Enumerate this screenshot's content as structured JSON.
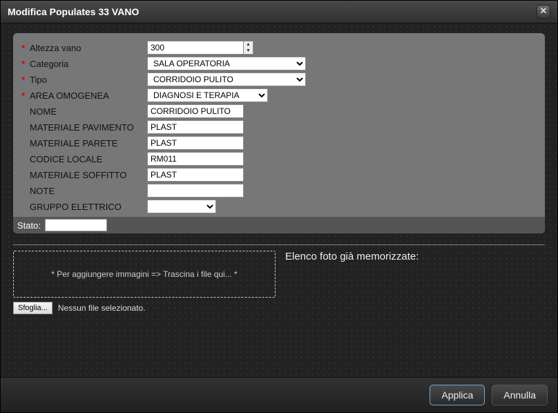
{
  "title": "Modifica Populates 33 VANO",
  "form": {
    "altezza_label": "Altezza vano",
    "altezza_value": "300",
    "categoria_label": "Categoria",
    "categoria_value": "SALA OPERATORIA",
    "tipo_label": "Tipo",
    "tipo_value": "CORRIDOIO PULITO",
    "area_label": "AREA OMOGENEA",
    "area_value": "DIAGNOSI E TERAPIA",
    "nome_label": "NOME",
    "nome_value": "CORRIDOIO PULITO",
    "mat_pav_label": "MATERIALE PAVIMENTO",
    "mat_pav_value": "PLAST",
    "mat_par_label": "MATERIALE PARETE",
    "mat_par_value": "PLAST",
    "codice_label": "CODICE LOCALE",
    "codice_value": "RM011",
    "mat_sof_label": "MATERIALE SOFFITTO",
    "mat_sof_value": "PLAST",
    "note_label": "NOTE",
    "note_value": "",
    "gruppo_label": "GRUPPO ELETTRICO",
    "gruppo_value": "",
    "stato_label": "Stato:",
    "stato_value": ""
  },
  "dropzone_text": "* Per aggiungere immagini => Trascina i file qui... *",
  "browse_label": "Sfoglia...",
  "no_file_text": "Nessun file selezionato.",
  "photo_list_title": "Elenco foto già memorizzate:",
  "buttons": {
    "apply": "Applica",
    "cancel": "Annulla"
  }
}
